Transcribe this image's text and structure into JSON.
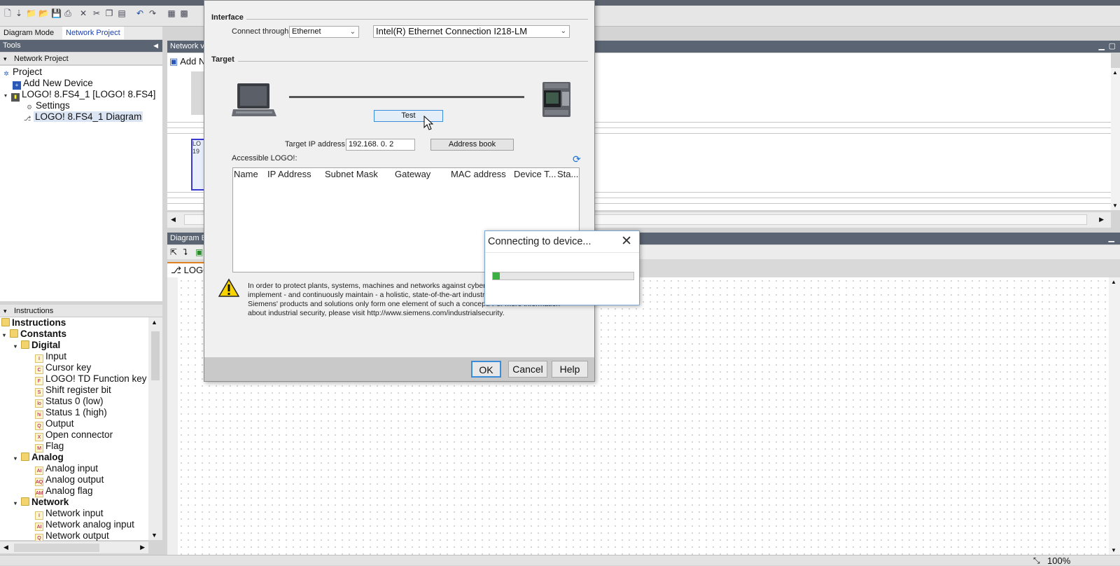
{
  "mode_tabs": {
    "diagram_mode": "Diagram Mode",
    "network_project": "Network Project"
  },
  "tools": {
    "title": "Tools",
    "network_project_header": "Network Project",
    "tree": {
      "project": "Project",
      "add_new_device": "Add New Device",
      "device": "LOGO! 8.FS4_1 [LOGO! 8.FS4]",
      "settings": "Settings",
      "diagram": "LOGO! 8.FS4_1 Diagram"
    }
  },
  "instructions": {
    "header": "Instructions",
    "root": "Instructions",
    "constants": "Constants",
    "digital": "Digital",
    "digital_items": [
      {
        "code": "I",
        "label": "Input"
      },
      {
        "code": "C",
        "label": "Cursor key"
      },
      {
        "code": "F",
        "label": "LOGO! TD Function key"
      },
      {
        "code": "S",
        "label": "Shift register bit"
      },
      {
        "code": "lo",
        "label": "Status 0 (low)"
      },
      {
        "code": "hi",
        "label": "Status 1 (high)"
      },
      {
        "code": "Q",
        "label": "Output"
      },
      {
        "code": "X",
        "label": "Open connector"
      },
      {
        "code": "M",
        "label": "Flag"
      }
    ],
    "analog": "Analog",
    "analog_items": [
      {
        "code": "AI",
        "label": "Analog input"
      },
      {
        "code": "AQ",
        "label": "Analog output"
      },
      {
        "code": "AM",
        "label": "Analog flag"
      }
    ],
    "network": "Network",
    "network_items": [
      {
        "code": "I",
        "label": "Network input"
      },
      {
        "code": "AI",
        "label": "Network analog input"
      },
      {
        "code": "Q",
        "label": "Network output"
      }
    ]
  },
  "network_view": {
    "title": "Network v",
    "add_label": "Add N",
    "device_text_1": "LO",
    "device_text_2": "19"
  },
  "diagram_editor": {
    "title": "Diagram E",
    "tab_label": "LOGO"
  },
  "dialog": {
    "interface_section": "Interface",
    "connect_through_label": "Connect through:",
    "connect_through_value": "Ethernet",
    "adapter_value": "Intel(R) Ethernet Connection I218-LM",
    "target_section": "Target",
    "test_button": "Test",
    "target_ip_label": "Target IP address:",
    "target_ip_value": "192.168.  0.  2",
    "address_book_button": "Address book",
    "accessible_label": "Accessible LOGO!:",
    "table_columns": [
      "Name",
      "IP Address",
      "Subnet Mask",
      "Gateway",
      "MAC address",
      "Device T...",
      "Sta..."
    ],
    "security_lines": [
      "In order to protect plants, systems, machines and networks against cyber t",
      "implement - and continuously maintain - a holistic, state-of-the-art industri",
      "Siemens' products and solutions only form one element of such a concept. For more information",
      "about industrial security, please visit http://www.siemens.com/industrialsecurity."
    ],
    "ok_button": "OK",
    "cancel_button": "Cancel",
    "help_button": "Help"
  },
  "connecting": {
    "title": "Connecting to device...",
    "progress": 0.05
  },
  "status": {
    "zoom": "100%"
  },
  "colors": {
    "header": "#5a6472",
    "accent": "#1a6fd0",
    "progress": "#3cb043"
  }
}
